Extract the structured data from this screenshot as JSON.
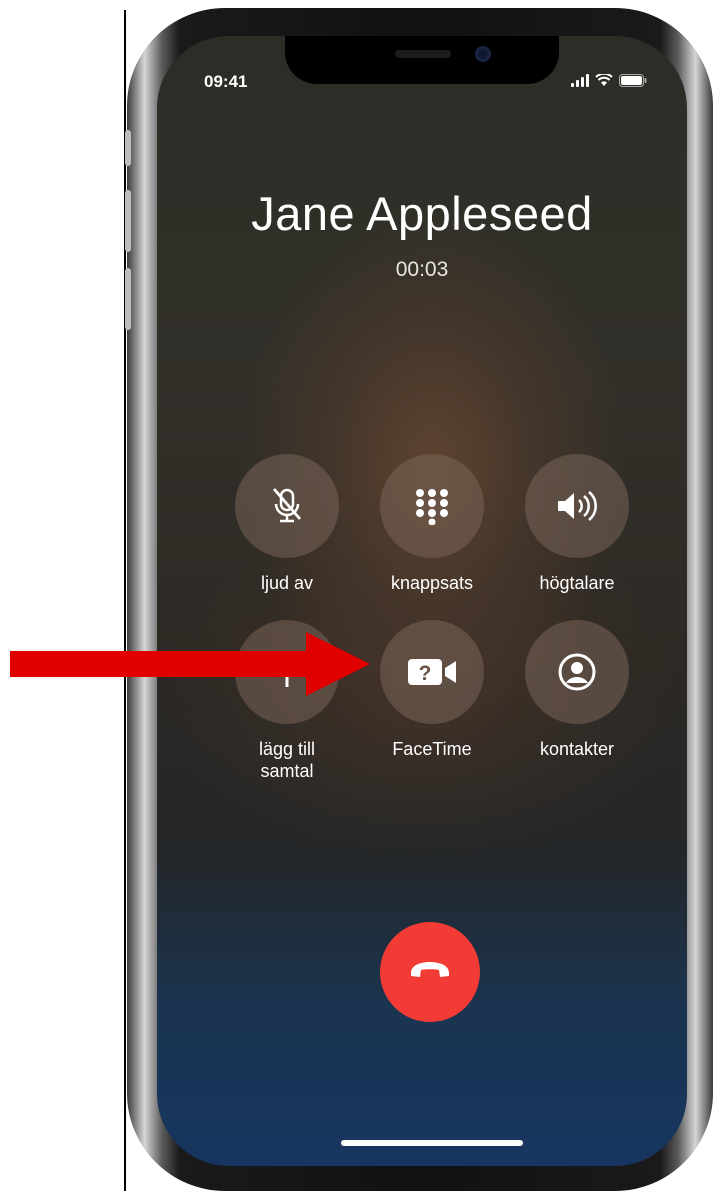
{
  "status_bar": {
    "time": "09:41"
  },
  "call": {
    "caller_name": "Jane Appleseed",
    "duration": "00:03"
  },
  "controls": [
    {
      "id": "mute",
      "label": "ljud av",
      "icon": "mic-slash-icon"
    },
    {
      "id": "keypad",
      "label": "knappsats",
      "icon": "keypad-icon"
    },
    {
      "id": "speaker",
      "label": "högtalare",
      "icon": "speaker-icon"
    },
    {
      "id": "add-call",
      "label": "lägg till\nsamtal",
      "icon": "plus-icon"
    },
    {
      "id": "facetime",
      "label": "FaceTime",
      "icon": "facetime-unavailable-icon"
    },
    {
      "id": "contacts",
      "label": "kontakter",
      "icon": "contact-icon"
    }
  ],
  "end_call": {
    "icon": "end-call-icon",
    "color": "#f23b35"
  },
  "annotation": {
    "type": "arrow",
    "color": "#e00000",
    "points_to": "FaceTime"
  }
}
